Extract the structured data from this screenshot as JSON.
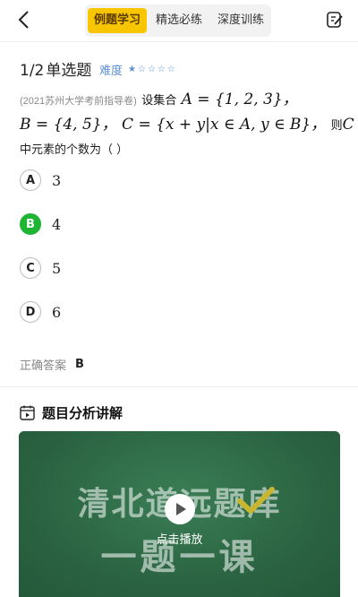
{
  "header": {
    "tabs": [
      {
        "label": "例题学习",
        "active": true
      },
      {
        "label": "精选必练",
        "active": false
      },
      {
        "label": "深度训练",
        "active": false
      }
    ],
    "back_icon": "chevron-left-icon",
    "edit_icon": "edit-note-icon"
  },
  "question": {
    "counter": "1/2",
    "type": "单选题",
    "difficulty_label": "难度",
    "difficulty_stars": {
      "filled": 1,
      "total": 5
    },
    "source": "(2021苏州大学考前指导卷)",
    "line1_text": "设集合",
    "line1_math": "A = {1, 2, 3}，",
    "line2_math_a": "B = {4, 5}，",
    "line2_math_b": "C = {x + y|x ∈ A, y ∈ B}，",
    "line2_then": "则",
    "line2_var": "C",
    "line3": "中元素的个数为（  ）"
  },
  "options": [
    {
      "letter": "A",
      "value": "3",
      "correct": false
    },
    {
      "letter": "B",
      "value": "4",
      "correct": true
    },
    {
      "letter": "C",
      "value": "5",
      "correct": false
    },
    {
      "letter": "D",
      "value": "6",
      "correct": false
    }
  ],
  "answer": {
    "label": "正确答案",
    "value": "B"
  },
  "analysis": {
    "title": "题目分析讲解",
    "icon": "video-calendar-icon",
    "video": {
      "board_line1": "清北道远题库",
      "board_line2": "一题一课",
      "play_label": "点击播放"
    }
  },
  "colors": {
    "tab_active": "#f7c600",
    "difficulty": "#5b8fd6",
    "correct": "#1fb534",
    "chalkboard": "#2d6a45"
  }
}
